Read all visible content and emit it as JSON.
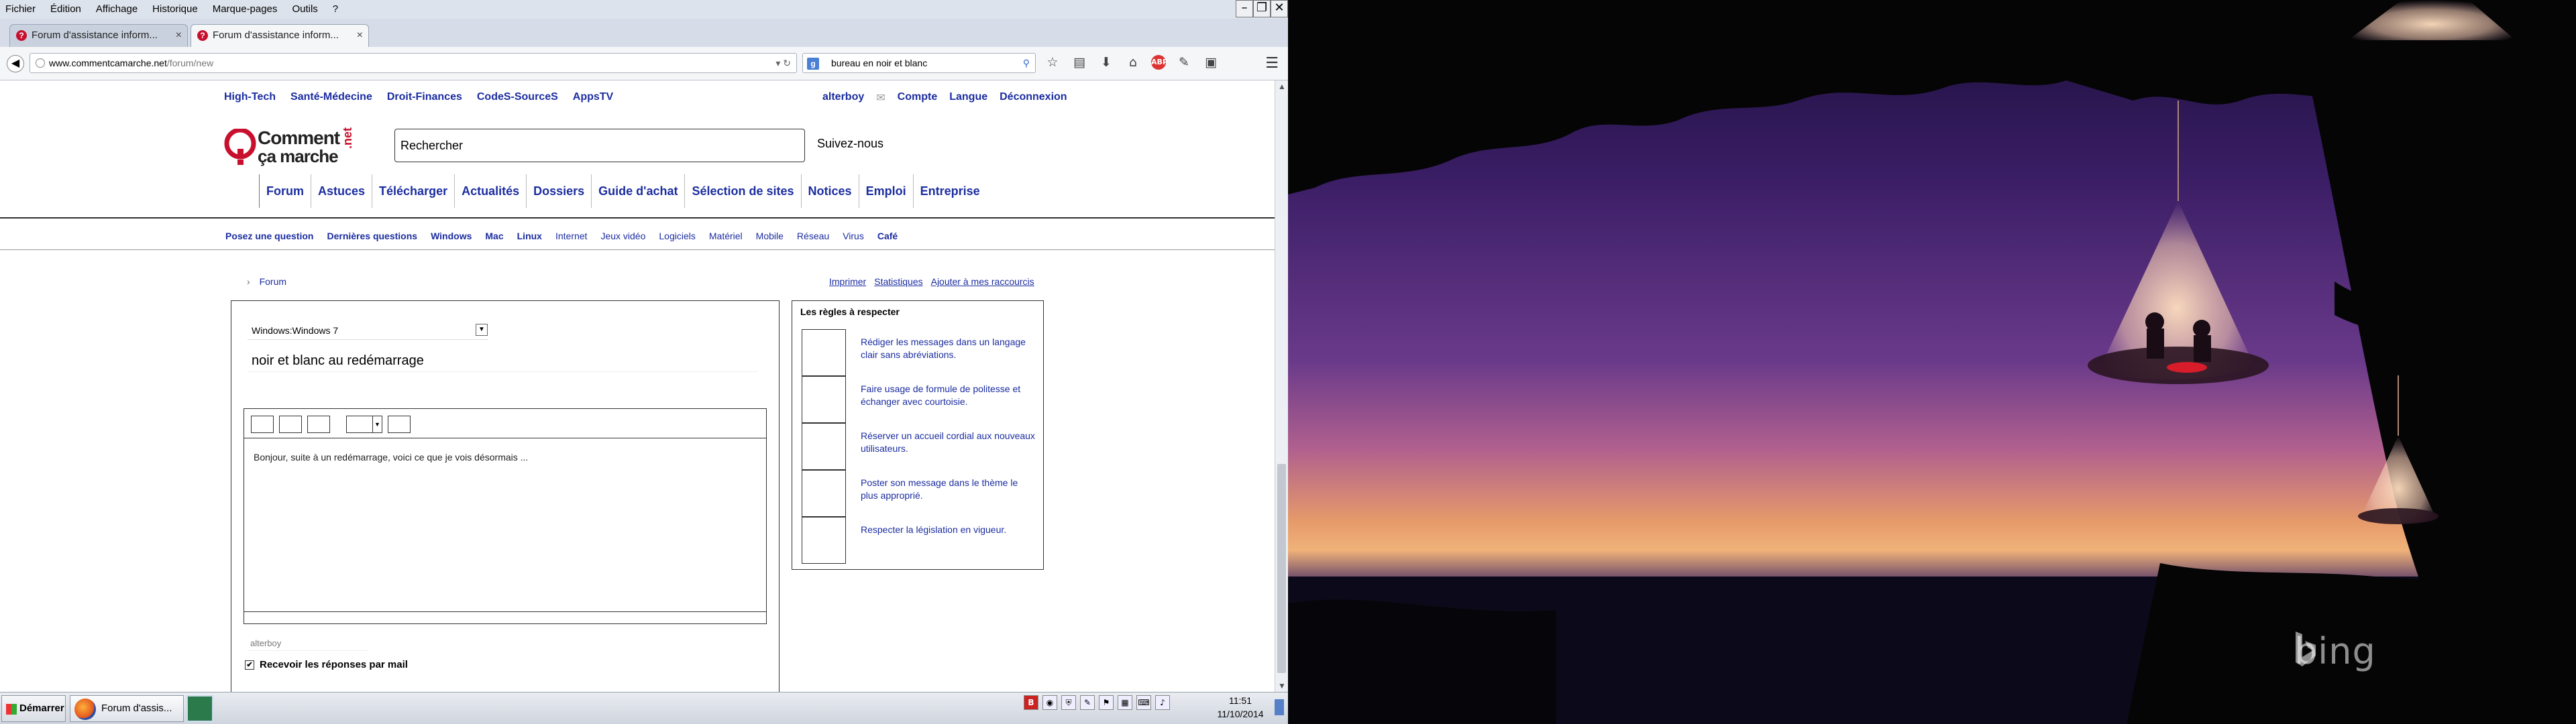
{
  "menubar": {
    "items": [
      "Fichier",
      "Édition",
      "Affichage",
      "Historique",
      "Marque-pages",
      "Outils",
      "?"
    ]
  },
  "tabs": [
    {
      "title": "Forum d'assistance inform...",
      "active": false
    },
    {
      "title": "Forum d'assistance inform...",
      "active": true
    }
  ],
  "navbar": {
    "url_host": "www.commentcamarche.net",
    "url_path": "/forum/new",
    "search_value": "bureau en noir et blanc"
  },
  "site": {
    "topnav": [
      "High-Tech",
      "Santé-Médecine",
      "Droit-Finances",
      "CodeS-SourceS",
      "AppsTV"
    ],
    "user": "alterboy",
    "userlinks": [
      "Compte",
      "Langue",
      "Déconnexion"
    ],
    "logo_line1": "Comment",
    "logo_line2": "ça marche",
    "logo_tld": ".net",
    "search_placeholder": "Rechercher",
    "follow": "Suivez-nous",
    "mainnav": [
      "Forum",
      "Astuces",
      "Télécharger",
      "Actualités",
      "Dossiers",
      "Guide d'achat",
      "Sélection de sites",
      "Notices",
      "Emploi",
      "Entreprise"
    ],
    "subnav": [
      "Posez une question",
      "Dernières questions",
      "Windows",
      "Mac",
      "Linux",
      "Internet",
      "Jeux vidéo",
      "Logiciels",
      "Matériel",
      "Mobile",
      "Réseau",
      "Virus",
      "Café"
    ],
    "breadcrumb": "Forum",
    "tools": [
      "Imprimer",
      "Statistiques",
      "Ajouter à mes raccourcis"
    ]
  },
  "form": {
    "category": "Windows:Windows 7",
    "subject": "noir et blanc au redémarrage",
    "body": "Bonjour, suite à un redémarrage, voici ce que je vois désormais ...",
    "username": "alterboy",
    "notify_label": "Recevoir les réponses par mail",
    "notify_checked": true
  },
  "rules": {
    "title": "Les règles à respecter",
    "items": [
      "Rédiger les messages dans un langage clair sans abréviations.",
      "Faire usage de formule de politesse et échanger avec courtoisie.",
      "Réserver un accueil cordial aux nouveaux utilisateurs.",
      "Poster son message dans le thème le plus approprié.",
      "Respecter la législation en vigueur."
    ]
  },
  "taskbar": {
    "start": "Démarrer",
    "task_label": "Forum d'assis...",
    "time": "11:51",
    "date": "11/10/2014"
  },
  "wallpaper": {
    "watermark": "bing"
  },
  "colors": {
    "link": "#1b2da0",
    "brand_red": "#c8102e"
  }
}
